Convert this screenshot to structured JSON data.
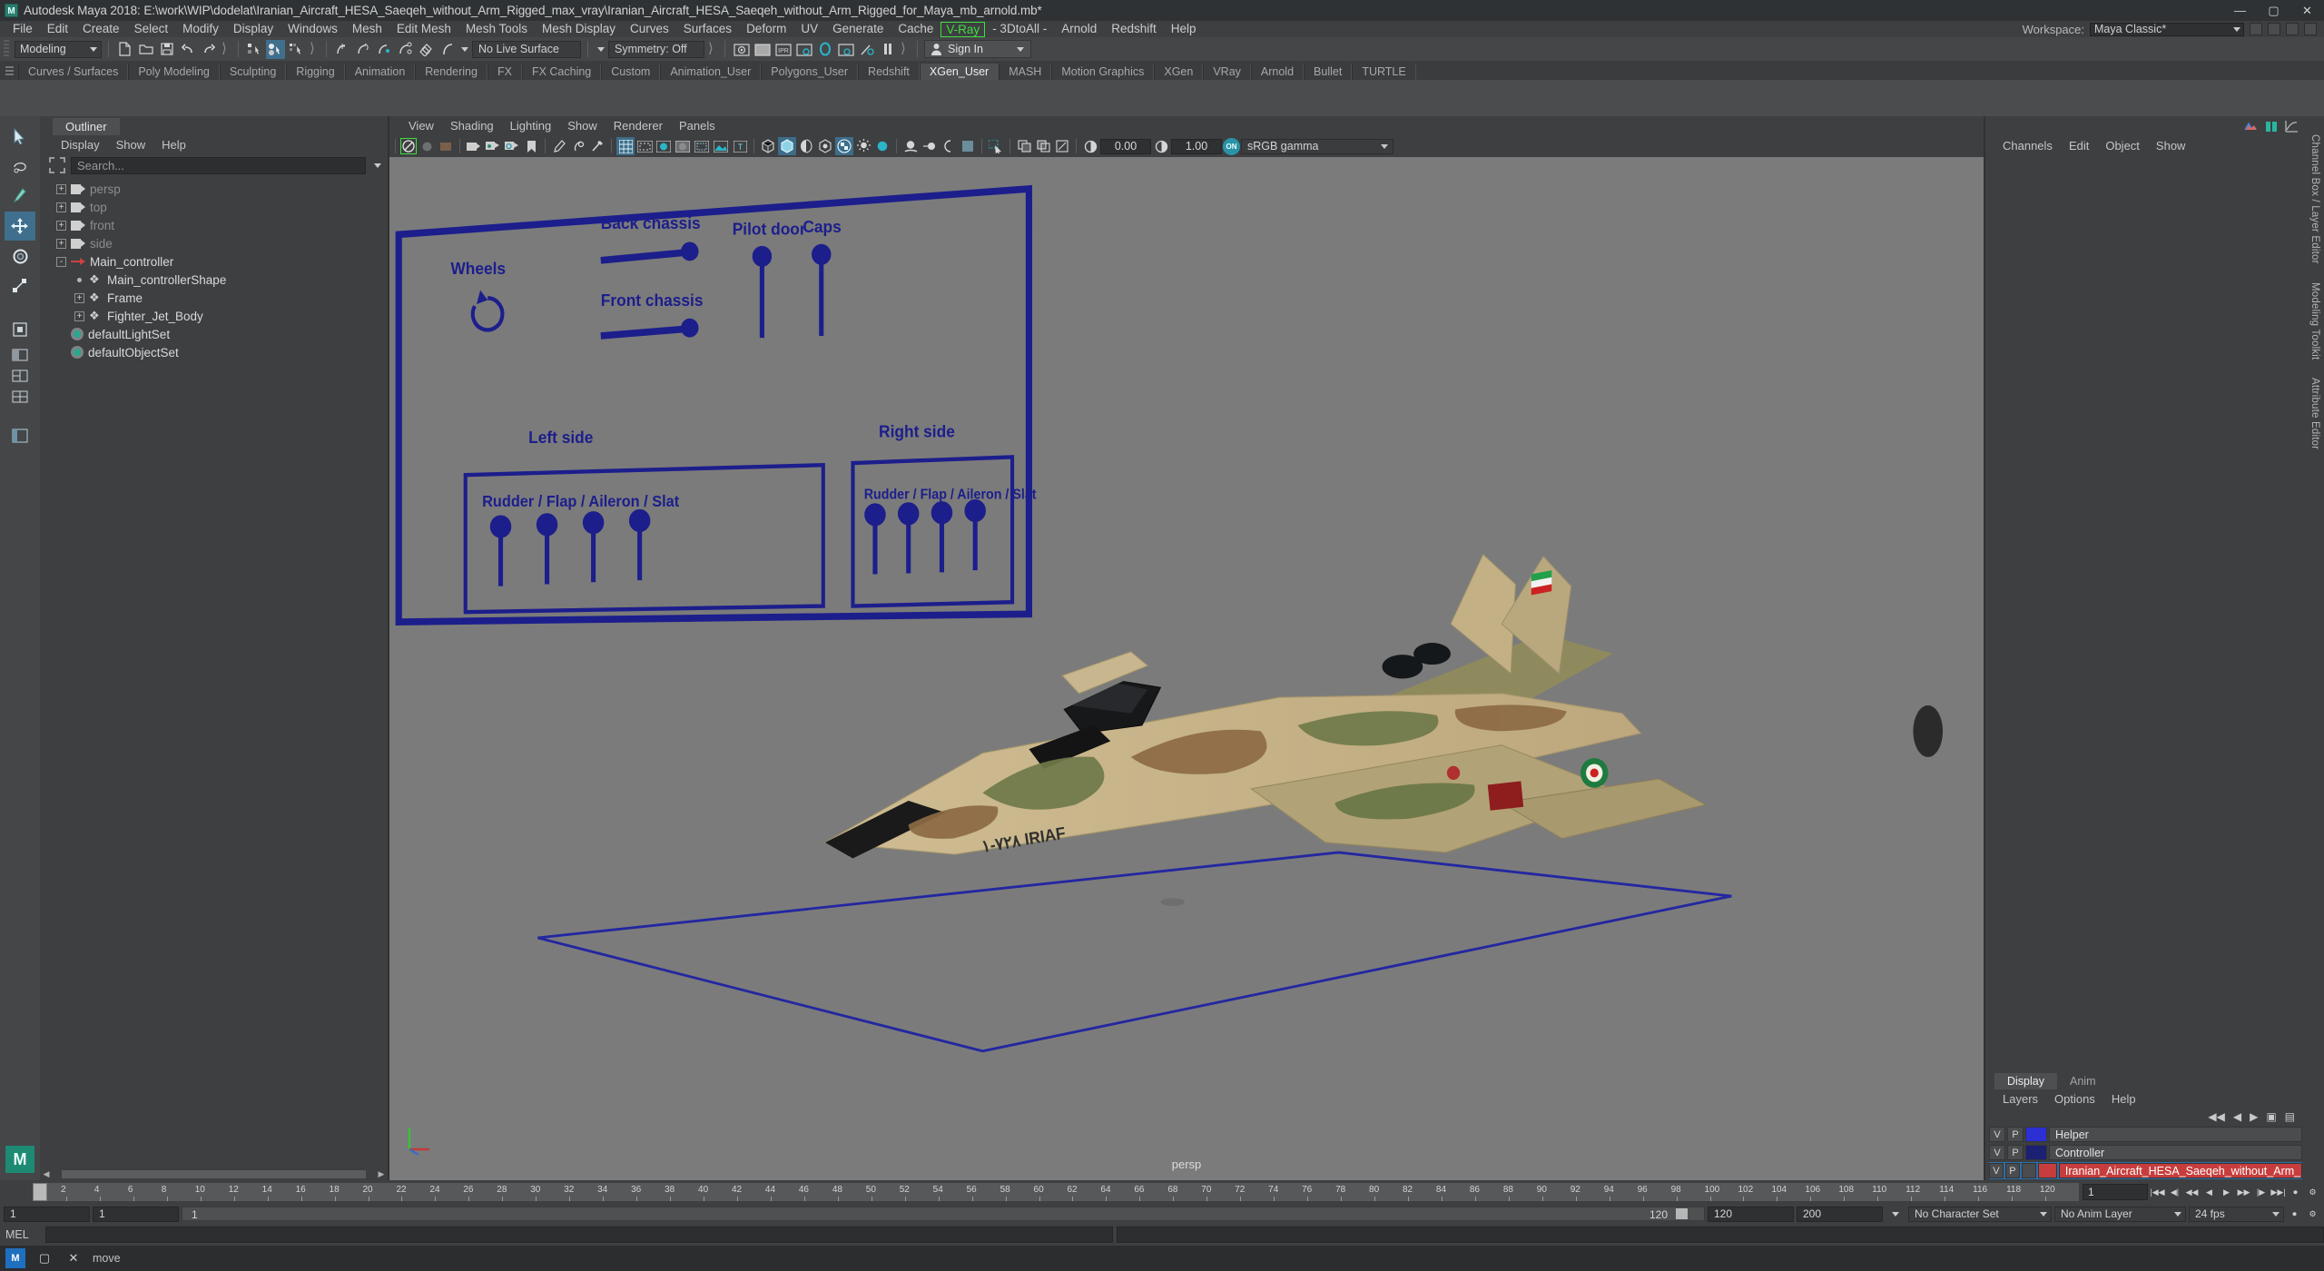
{
  "titlebar": {
    "app_title": "Autodesk Maya 2018: E:\\work\\WIP\\dodelat\\Iranian_Aircraft_HESA_Saeqeh_without_Arm_Rigged_max_vray\\Iranian_Aircraft_HESA_Saeqeh_without_Arm_Rigged_for_Maya_mb_arnold.mb*",
    "logo": "M",
    "minimize": "—",
    "maximize": "▢",
    "close": "✕"
  },
  "menubar": {
    "items": [
      "File",
      "Edit",
      "Create",
      "Select",
      "Modify",
      "Display",
      "Windows",
      "Mesh",
      "Edit Mesh",
      "Mesh Tools",
      "Mesh Display",
      "Curves",
      "Surfaces",
      "Deform",
      "UV",
      "Generate",
      "Cache",
      "V-Ray",
      "- 3DtoAll -",
      "Arnold",
      "Redshift",
      "Help"
    ],
    "highlight_item": "V-Ray",
    "highlight_color": "#3fdf3f",
    "workspace_label": "Workspace:",
    "workspace_value": "Maya Classic*"
  },
  "toolbar": {
    "menu_set": "Modeling",
    "live_surface": "No Live Surface",
    "symmetry": "Symmetry: Off",
    "signin": "Sign In"
  },
  "shelf": {
    "tabs": [
      "Curves / Surfaces",
      "Poly Modeling",
      "Sculpting",
      "Rigging",
      "Animation",
      "Rendering",
      "FX",
      "FX Caching",
      "Custom",
      "Animation_User",
      "Polygons_User",
      "Redshift",
      "XGen_User",
      "MASH",
      "Motion Graphics",
      "XGen",
      "VRay",
      "Arnold",
      "Bullet",
      "TURTLE"
    ],
    "active_tab": "XGen_User"
  },
  "outliner": {
    "tab_title": "Outliner",
    "menus": [
      "Display",
      "Show",
      "Help"
    ],
    "search_placeholder": "Search...",
    "tree": [
      {
        "label": "persp",
        "indent": 0,
        "expander": "+",
        "icon": "camera-icon",
        "dim": true
      },
      {
        "label": "top",
        "indent": 0,
        "expander": "+",
        "icon": "camera-icon",
        "dim": true
      },
      {
        "label": "front",
        "indent": 0,
        "expander": "+",
        "icon": "camera-icon",
        "dim": true
      },
      {
        "label": "side",
        "indent": 0,
        "expander": "+",
        "icon": "camera-icon",
        "dim": true
      },
      {
        "label": "Main_controller",
        "indent": 0,
        "expander": "-",
        "icon": "controller-icon",
        "dim": false
      },
      {
        "label": "Main_controllerShape",
        "indent": 1,
        "expander": ".",
        "icon": "mesh-icon",
        "dim": false
      },
      {
        "label": "Frame",
        "indent": 1,
        "expander": "+",
        "icon": "mesh-icon",
        "dim": false
      },
      {
        "label": "Fighter_Jet_Body",
        "indent": 1,
        "expander": "+",
        "icon": "mesh-icon",
        "dim": false
      },
      {
        "label": "defaultLightSet",
        "indent": 0,
        "expander": "",
        "icon": "set-icon",
        "dim": false
      },
      {
        "label": "defaultObjectSet",
        "indent": 0,
        "expander": "",
        "icon": "set-icon",
        "dim": false
      }
    ]
  },
  "viewport": {
    "menus": [
      "View",
      "Shading",
      "Lighting",
      "Show",
      "Renderer",
      "Panels"
    ],
    "exposure_value": "0.00",
    "gamma_value": "1.00",
    "color_mgmt_toggle": "ON",
    "color_profile": "sRGB gamma",
    "camera_label": "persp",
    "background_color": "#7b7b7b",
    "control_panel": {
      "accent_color": "#1c1e8c",
      "labels": {
        "wheels": "Wheels",
        "back_chassis": "Back chassis",
        "front_chassis": "Front chassis",
        "pilot_door": "Pilot door",
        "caps": "Caps",
        "left_side": "Left side",
        "right_side": "Right side",
        "left_group": "Rudder / Flap / Aileron / Slat",
        "right_group": "Rudder / Flap / Aileron / Slat"
      }
    },
    "aircraft_markings": "1-TA IRIAF"
  },
  "channelbox": {
    "menus": [
      "Channels",
      "Edit",
      "Object",
      "Show"
    ],
    "tabs": [
      "Display",
      "Anim"
    ],
    "active_tab": "Display",
    "sub_menus": [
      "Layers",
      "Options",
      "Help"
    ],
    "column_v": "V",
    "column_p": "P",
    "layers": [
      {
        "v": "V",
        "p": "P",
        "color": "#2b2fd4",
        "name": "Helper",
        "selected": false
      },
      {
        "v": "V",
        "p": "P",
        "color": "#1b2072",
        "name": "Controller",
        "selected": false
      },
      {
        "v": "V",
        "p": "P",
        "color": "#c73d3d",
        "name": "Iranian_Aircraft_HESA_Saeqeh_without_Arm_Rigged",
        "selected": true
      }
    ]
  },
  "right_docks": [
    "Channel Box / Layer Editor",
    "Modeling Toolkit",
    "Attribute Editor"
  ],
  "timeline": {
    "ticks": [
      "2",
      "4",
      "6",
      "8",
      "10",
      "12",
      "14",
      "16",
      "18",
      "20",
      "22",
      "24",
      "26",
      "28",
      "30",
      "32",
      "34",
      "36",
      "38",
      "40",
      "42",
      "44",
      "46",
      "48",
      "50",
      "52",
      "54",
      "56",
      "58",
      "60",
      "62",
      "64",
      "66",
      "68",
      "70",
      "72",
      "74",
      "76",
      "78",
      "80",
      "82",
      "84",
      "86",
      "88",
      "90",
      "92",
      "94",
      "96",
      "98",
      "100",
      "102",
      "104",
      "106",
      "108",
      "110",
      "112",
      "114",
      "116",
      "118",
      "120"
    ],
    "current_frame": "1",
    "current_frame_field": "1"
  },
  "range": {
    "start": "1",
    "range_start": "1",
    "range_end": "120",
    "playback_end": "120",
    "anim_end": "200",
    "character_set": "No Character Set",
    "anim_layer": "No Anim Layer",
    "fps": "24 fps"
  },
  "command": {
    "mel_label": "MEL"
  },
  "taskbar": {
    "status": "move"
  }
}
